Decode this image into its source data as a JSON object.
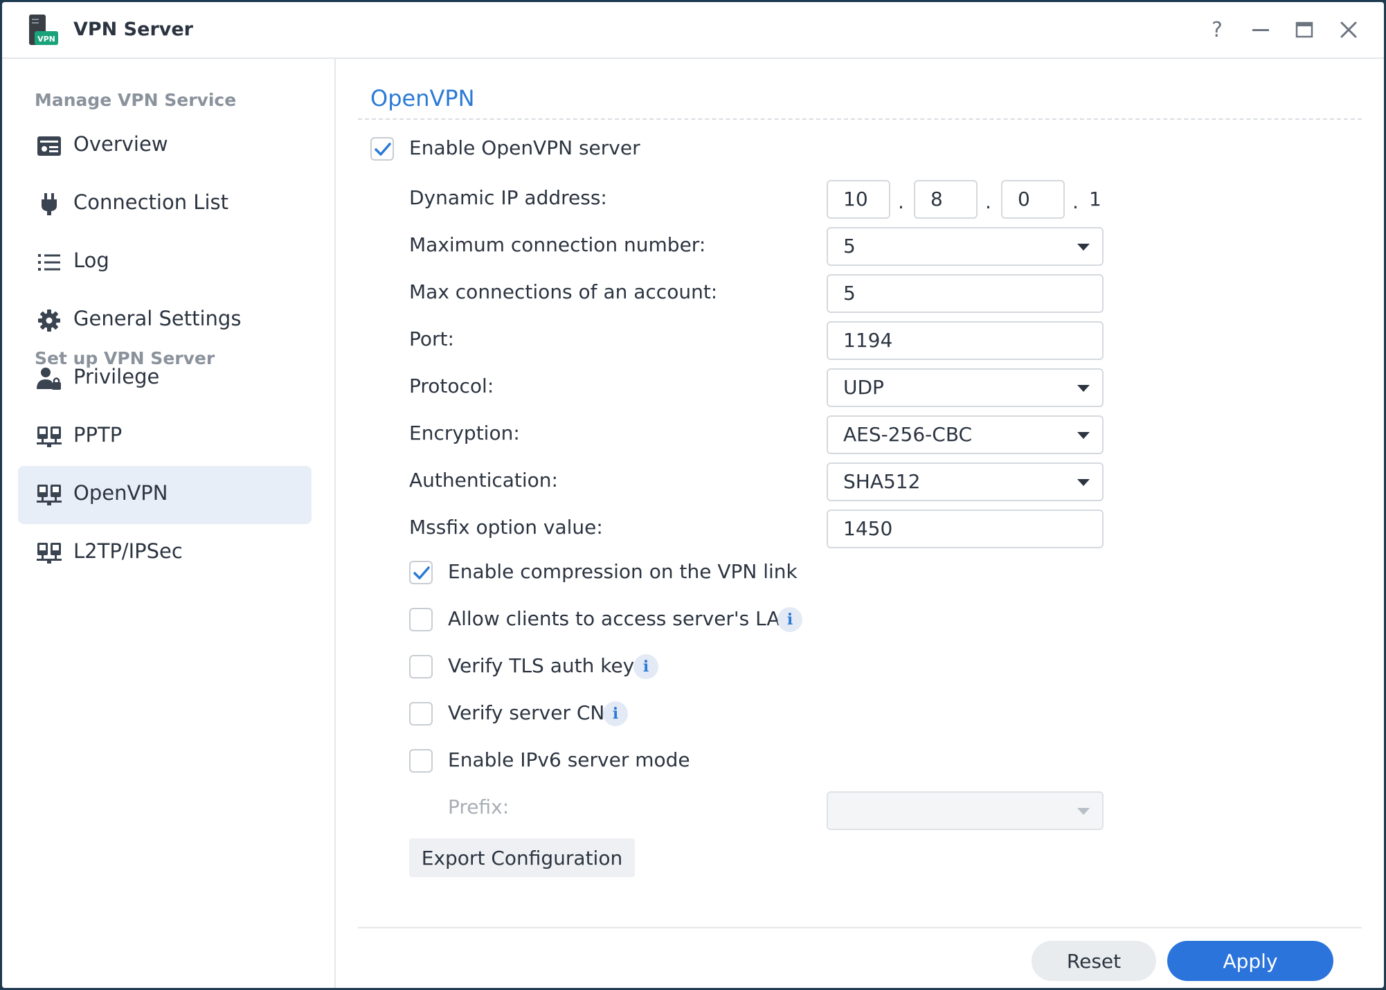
{
  "window": {
    "title": "VPN Server",
    "icon": "vpn-server-app-icon",
    "icon_text": "VPN",
    "controls": [
      "help-icon",
      "minimize-icon",
      "maximize-icon",
      "close-icon"
    ],
    "help_glyph": "?"
  },
  "sidebar": {
    "section1_title": "Manage VPN Service",
    "manage_items": [
      {
        "label": "Overview",
        "icon": "overview-icon"
      },
      {
        "label": "Connection List",
        "icon": "plug-icon"
      },
      {
        "label": "Log",
        "icon": "list-icon"
      },
      {
        "label": "General Settings",
        "icon": "gear-icon"
      },
      {
        "label": "Privilege",
        "icon": "user-lock-icon"
      }
    ],
    "section2_title": "Set up VPN Server",
    "setup_items": [
      {
        "label": "PPTP",
        "icon": "network-icon"
      },
      {
        "label": "OpenVPN",
        "icon": "network-icon",
        "active": true
      },
      {
        "label": "L2TP/IPSec",
        "icon": "network-icon"
      }
    ]
  },
  "main": {
    "title": "OpenVPN",
    "enable_server": {
      "label": "Enable OpenVPN server",
      "checked": true
    },
    "dynamic_ip": {
      "label": "Dynamic IP address:",
      "octets": [
        "10",
        "8",
        "0"
      ],
      "last": "1",
      "dot": "."
    },
    "max_connections": {
      "label": "Maximum connection number:",
      "value": "5"
    },
    "max_account": {
      "label": "Max connections of an account:",
      "value": "5"
    },
    "port": {
      "label": "Port:",
      "value": "1194"
    },
    "protocol": {
      "label": "Protocol:",
      "value": "UDP"
    },
    "encryption": {
      "label": "Encryption:",
      "value": "AES-256-CBC"
    },
    "authentication": {
      "label": "Authentication:",
      "value": "SHA512"
    },
    "mssfix": {
      "label": "Mssfix option value:",
      "value": "1450"
    },
    "options": [
      {
        "label": "Enable compression on the VPN link",
        "checked": true,
        "info": false
      },
      {
        "label": "Allow clients to access server's LAN",
        "checked": false,
        "info": true
      },
      {
        "label": "Verify TLS auth key",
        "checked": false,
        "info": true
      },
      {
        "label": "Verify server CN",
        "checked": false,
        "info": true
      },
      {
        "label": "Enable IPv6 server mode",
        "checked": false,
        "info": false
      }
    ],
    "info_glyph": "i",
    "prefix": {
      "label": "Prefix:",
      "value": "",
      "disabled": true
    },
    "export_button": "Export Configuration",
    "reset_button": "Reset",
    "apply_button": "Apply"
  },
  "colors": {
    "accent": "#2a7ad6",
    "apply": "#2b74db",
    "active_nav": "#e8eef7"
  }
}
